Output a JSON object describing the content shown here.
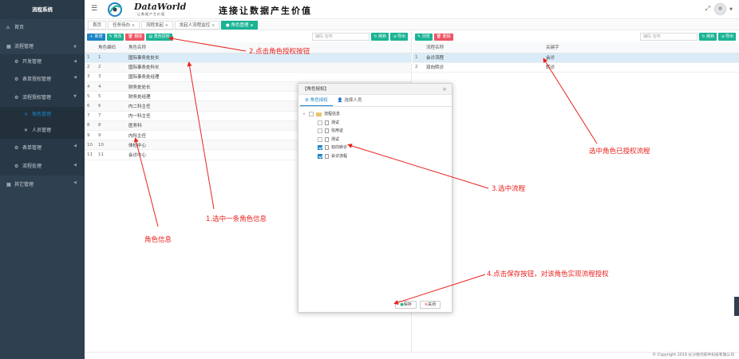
{
  "sidebar": {
    "title": "流程系统",
    "items": [
      {
        "label": "首页"
      },
      {
        "label": "流程管理"
      },
      {
        "label": "开发管理"
      },
      {
        "label": "表单授权管理"
      },
      {
        "label": "流程授权管理"
      },
      {
        "label": "角色管理"
      },
      {
        "label": "人员管理"
      },
      {
        "label": "表单管理"
      },
      {
        "label": "流程处理"
      },
      {
        "label": "其它管理"
      }
    ]
  },
  "header": {
    "brand": "DataWorld",
    "brand_sub": "让数据产生价值",
    "slogan": "连接让数据产生价值"
  },
  "tabs": [
    {
      "label": "首页"
    },
    {
      "label": "任务待办"
    },
    {
      "label": "流程发起"
    },
    {
      "label": "发起人流程监控"
    },
    {
      "label": "角色管理"
    }
  ],
  "left": {
    "buttons": {
      "add": "新增",
      "edit": "修改",
      "delete": "删除",
      "grant": "角色授权"
    },
    "search_placeholder": "编码 名称",
    "refresh": "刷新",
    "export": "导出",
    "columns": [
      "角色编码",
      "角色名称"
    ],
    "rows": [
      {
        "n": "1",
        "code": "1",
        "name": "国际事务处处长"
      },
      {
        "n": "2",
        "code": "2",
        "name": "国际事务处科长"
      },
      {
        "n": "3",
        "code": "3",
        "name": "国际事务处经理"
      },
      {
        "n": "4",
        "code": "4",
        "name": "财务处处长"
      },
      {
        "n": "5",
        "code": "5",
        "name": "财务处经理"
      },
      {
        "n": "6",
        "code": "6",
        "name": "内二科主任"
      },
      {
        "n": "7",
        "code": "7",
        "name": "内一科主任"
      },
      {
        "n": "8",
        "code": "8",
        "name": "医务科"
      },
      {
        "n": "9",
        "code": "9",
        "name": "内科主任"
      },
      {
        "n": "10",
        "code": "10",
        "name": "体检中心"
      },
      {
        "n": "11",
        "code": "11",
        "name": "会诊中心"
      }
    ]
  },
  "right": {
    "buttons": {
      "browse": "浏览",
      "delete": "删除"
    },
    "search_placeholder": "编码 名称",
    "refresh": "刷新",
    "export": "导出",
    "columns": [
      "流程名称",
      "关键字"
    ],
    "rows": [
      {
        "n": "1",
        "name": "会诊流程",
        "key": "会诊"
      },
      {
        "n": "2",
        "name": "双向转诊",
        "key": "转诊"
      }
    ]
  },
  "modal": {
    "title": "【角色授权】",
    "tab1": "角色授权",
    "tab2": "选择人员",
    "tree_root": "流程信息",
    "tree_items": [
      {
        "label": "测试",
        "checked": false
      },
      {
        "label": "信用证",
        "checked": false
      },
      {
        "label": "测试",
        "checked": false
      },
      {
        "label": "双向转诊",
        "checked": true
      },
      {
        "label": "会诊流程",
        "checked": true
      }
    ],
    "save": "保存",
    "close": "关闭"
  },
  "annotations": {
    "a1": "1.选中一条角色信息",
    "a2": "2.点击角色授权按钮",
    "a3": "3.选中流程",
    "a4": "4.点击保存按钮，对该角色实现流程授权",
    "a5": "选中角色已授权流程",
    "a6": "角色信息"
  },
  "footer": "© Copyright 2019 长沙德鸿软件科技有限公司",
  "colors": {
    "sidebar": "#2f4050",
    "green": "#1ab394",
    "blue": "#1c84c6",
    "red": "#ed5565",
    "annotation": "#e8231f"
  }
}
